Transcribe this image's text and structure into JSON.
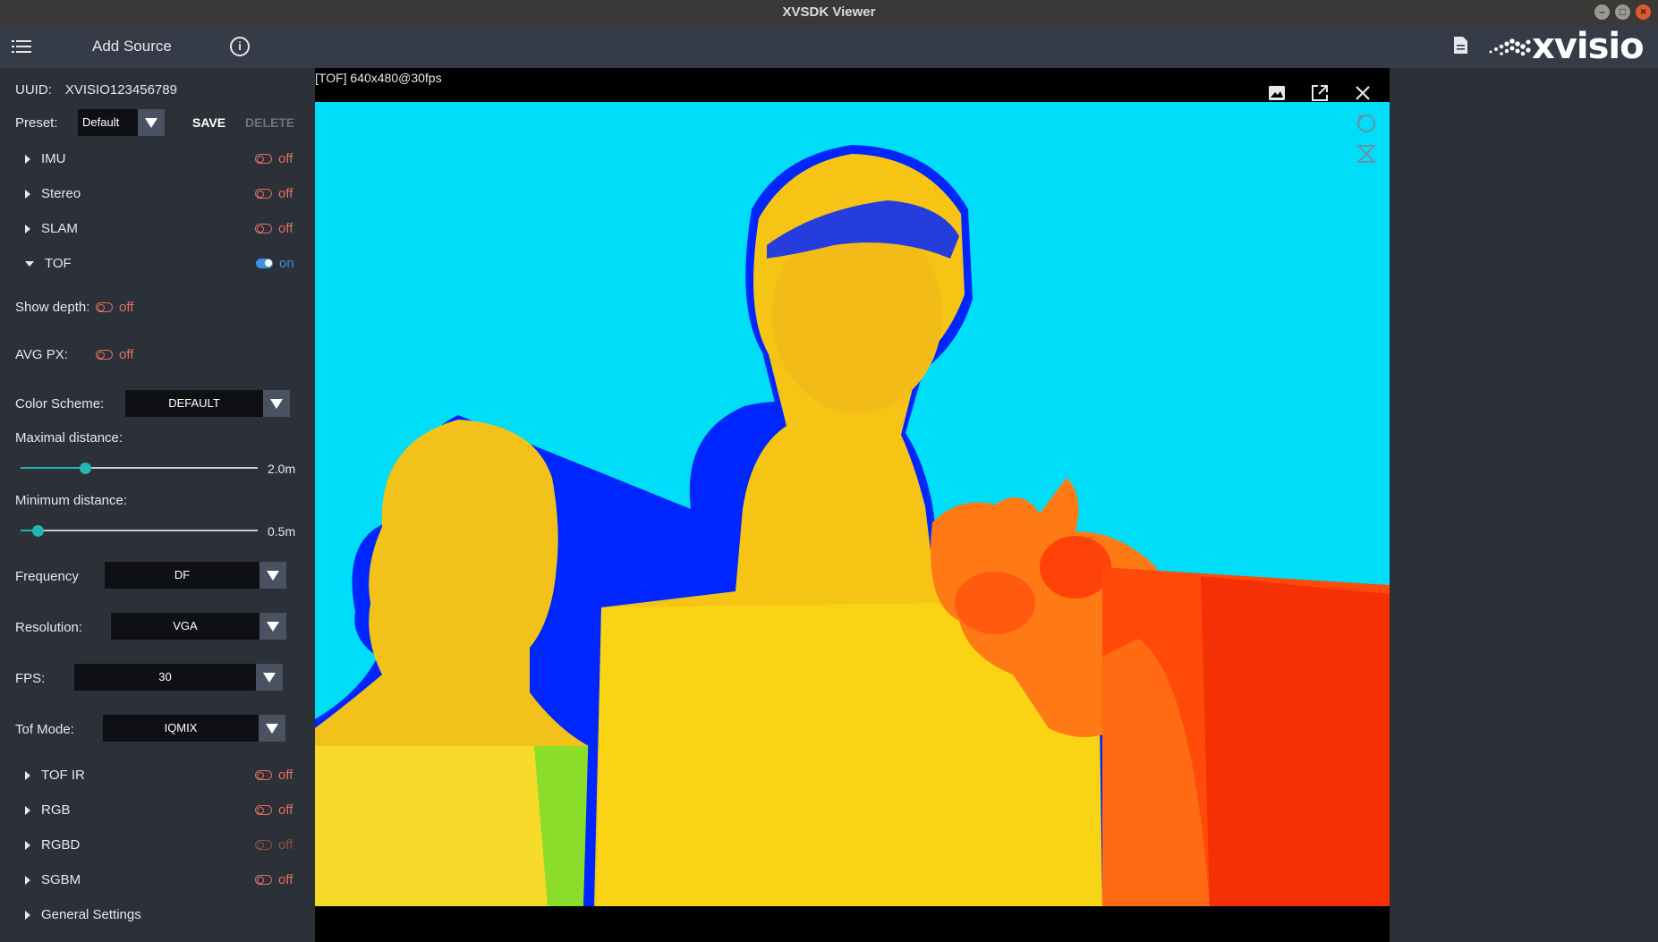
{
  "window": {
    "title": "XVSDK Viewer"
  },
  "topbar": {
    "add_source": "Add Source",
    "logo": "xvisio"
  },
  "sidebar": {
    "uuid_label": "UUID:",
    "uuid_value": "XVISIO123456789",
    "preset_label": "Preset:",
    "preset_value": "Default",
    "save": "SAVE",
    "delete": "DELETE",
    "sections": [
      {
        "name": "IMU",
        "state": "off"
      },
      {
        "name": "Stereo",
        "state": "off"
      },
      {
        "name": "SLAM",
        "state": "off"
      },
      {
        "name": "TOF",
        "state": "on"
      }
    ],
    "tof": {
      "show_depth_label": "Show depth:",
      "show_depth_state": "off",
      "avg_px_label": "AVG PX:",
      "avg_px_state": "off",
      "color_scheme_label": "Color Scheme:",
      "color_scheme_value": "DEFAULT",
      "max_distance_label": "Maximal distance:",
      "max_distance_value": "2.0m",
      "max_distance_fraction": 0.27,
      "min_distance_label": "Minimum distance:",
      "min_distance_value": "0.5m",
      "min_distance_fraction": 0.07,
      "frequency_label": "Frequency",
      "frequency_value": "DF",
      "resolution_label": "Resolution:",
      "resolution_value": "VGA",
      "fps_label": "FPS:",
      "fps_value": "30",
      "tof_mode_label": "Tof Mode:",
      "tof_mode_value": "IQMIX"
    },
    "sections2": [
      {
        "name": "TOF IR",
        "state": "off"
      },
      {
        "name": "RGB",
        "state": "off"
      },
      {
        "name": "RGBD",
        "state": "off"
      },
      {
        "name": "SGBM",
        "state": "off"
      },
      {
        "name": "General Settings"
      }
    ]
  },
  "viewer": {
    "title": "[TOF]  640x480@30fps"
  },
  "colors": {
    "accent": "#3f8fe0",
    "off": "#e07060",
    "slider": "#20b8b0",
    "depth_bg": "#00ddf8"
  }
}
